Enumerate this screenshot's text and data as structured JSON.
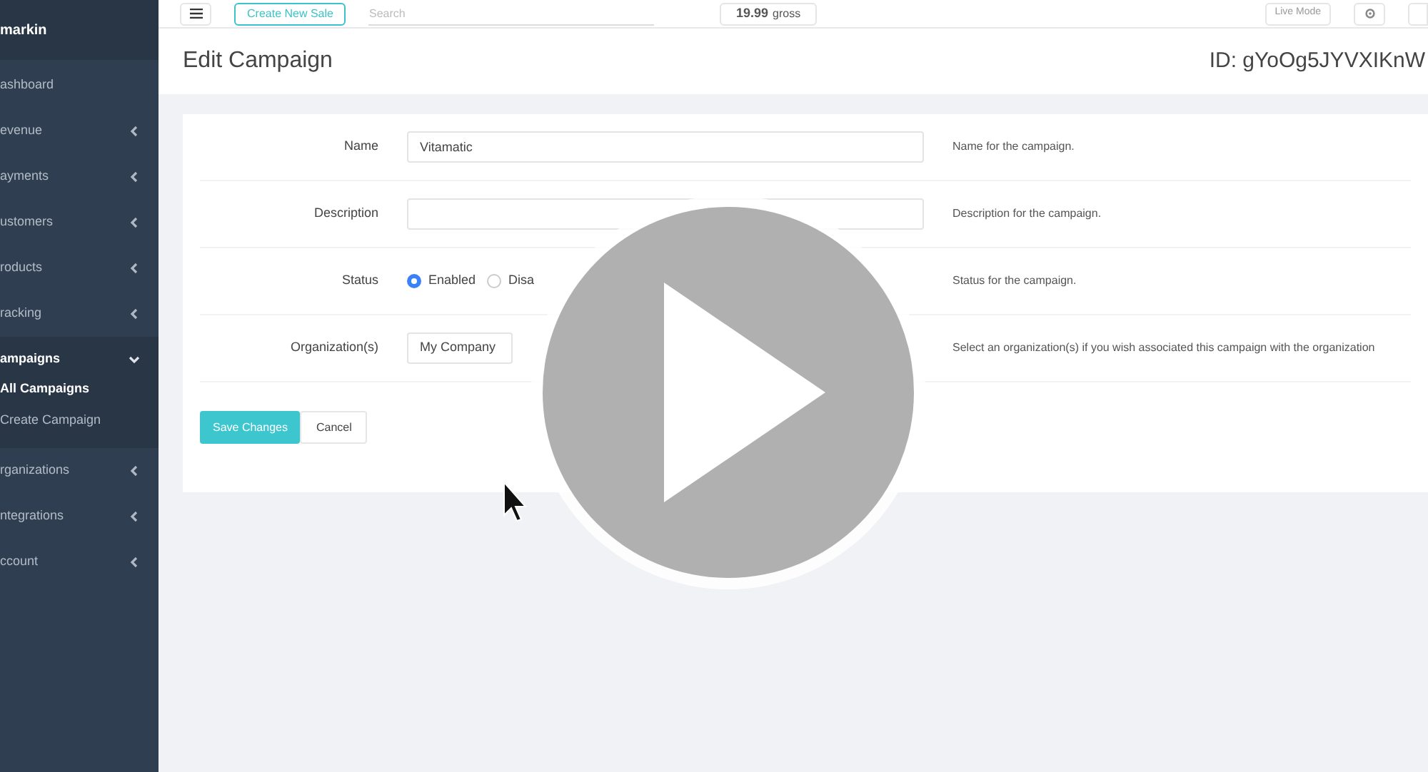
{
  "sidebar": {
    "user": "markin",
    "items": [
      {
        "label": "ashboard",
        "expandable": false,
        "expanded": false
      },
      {
        "label": "evenue",
        "expandable": true,
        "expanded": false
      },
      {
        "label": "ayments",
        "expandable": true,
        "expanded": false
      },
      {
        "label": "ustomers",
        "expandable": true,
        "expanded": false
      },
      {
        "label": "roducts",
        "expandable": true,
        "expanded": false
      },
      {
        "label": "racking",
        "expandable": true,
        "expanded": false
      },
      {
        "label": "ampaigns",
        "expandable": true,
        "expanded": true,
        "children": [
          {
            "label": "All Campaigns",
            "selected": true
          },
          {
            "label": "Create Campaign",
            "selected": false
          }
        ]
      },
      {
        "label": "rganizations",
        "expandable": true,
        "expanded": false
      },
      {
        "label": "ntegrations",
        "expandable": true,
        "expanded": false
      },
      {
        "label": "ccount",
        "expandable": true,
        "expanded": false
      }
    ]
  },
  "topbar": {
    "create_button": "Create New Sale",
    "search": {
      "placeholder": "Search"
    },
    "total": {
      "amount": "19.99",
      "suffix": "gross"
    },
    "mode_button": "Live Mode"
  },
  "page": {
    "title": "Edit Campaign",
    "id": "ID: gYoOg5JYVXIKnW"
  },
  "form": {
    "rows": [
      {
        "kind": "text",
        "label": "Name",
        "value": "Vitamatic",
        "help": "Name for the campaign."
      },
      {
        "kind": "text",
        "label": "Description",
        "value": "",
        "help": "Description for the campaign."
      },
      {
        "kind": "radio",
        "label": "Status",
        "options": [
          {
            "label": "Enabled",
            "selected": true
          },
          {
            "label": "Disa",
            "selected": false
          }
        ],
        "help": "Status for the campaign."
      },
      {
        "kind": "select",
        "label": "Organization(s)",
        "value": "My Company",
        "help": "Select an organization(s) if you wish associated this campaign with the organization"
      }
    ],
    "save_button": "Save Changes",
    "cancel_button": "Cancel"
  }
}
